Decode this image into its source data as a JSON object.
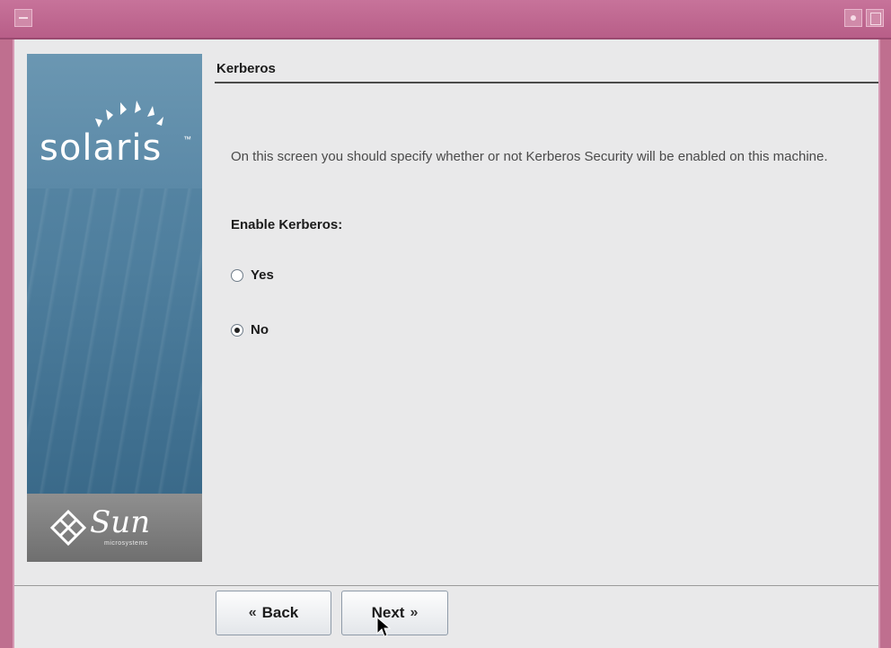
{
  "window": {
    "colors": {
      "titlebar": "#c2688f",
      "banner": "#4f7f9e"
    }
  },
  "banner": {
    "brand": "solaris",
    "vendor": "Sun",
    "vendor_sub": "microsystems"
  },
  "section": {
    "title": "Kerberos"
  },
  "description": "On this screen you should specify whether or not Kerberos Security will be enabled on this machine.",
  "enable_kerberos": {
    "label": "Enable Kerberos:",
    "options": [
      {
        "label": "Yes",
        "selected": false
      },
      {
        "label": "No",
        "selected": true
      }
    ]
  },
  "nav": {
    "back_label": "Back",
    "next_label": "Next"
  }
}
